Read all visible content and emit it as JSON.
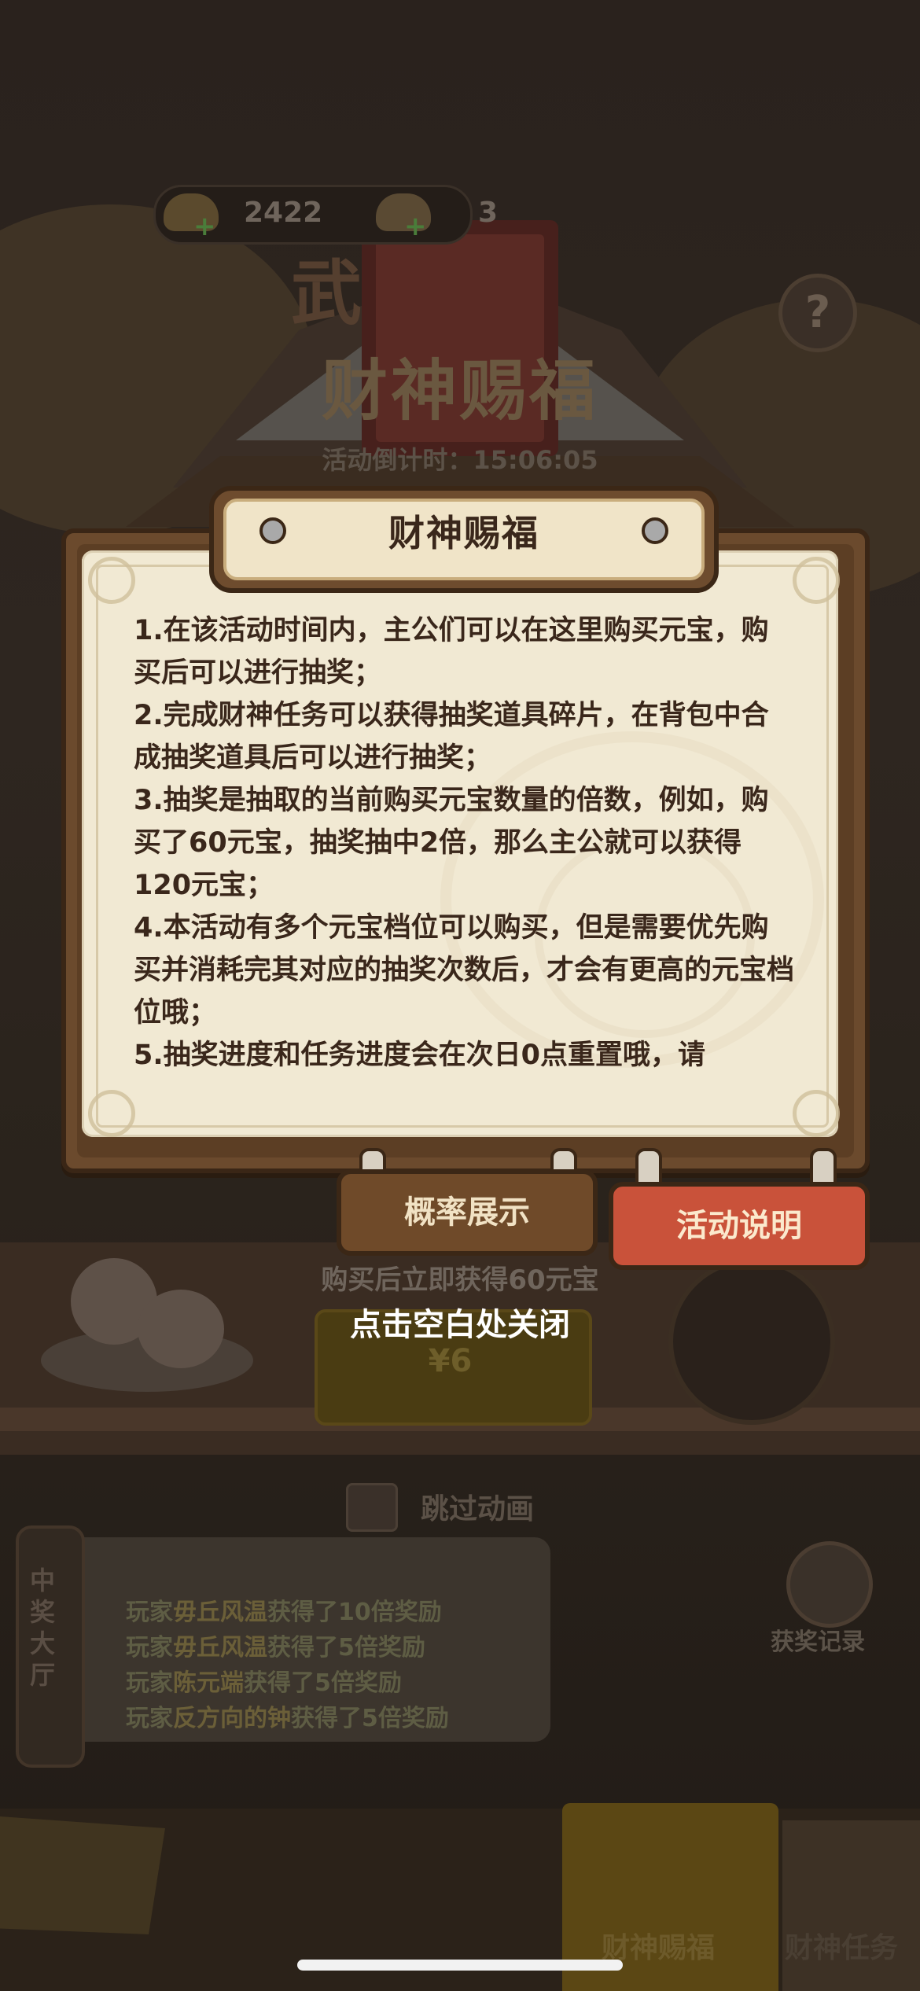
{
  "background": {
    "currency": {
      "ingots": "2422",
      "fragments": "3"
    },
    "event_title": "财神赐福",
    "countdown": "活动倒计时：15:06:05",
    "banner_char": "武",
    "buy_hint": "购买后立即获得60元宝",
    "price": "¥6",
    "skip_animation": "跳过动画",
    "hall_label": "中奖大厅",
    "news": [
      {
        "prefix": "玩家",
        "name": "毋丘风温",
        "suffix": "获得了10倍奖励"
      },
      {
        "prefix": "玩家",
        "name": "毋丘风温",
        "suffix": "获得了5倍奖励"
      },
      {
        "prefix": "玩家",
        "name": "陈元端",
        "suffix": "获得了5倍奖励"
      },
      {
        "prefix": "玩家",
        "name": "反方向的钟",
        "suffix": "获得了5倍奖励"
      }
    ],
    "record_label": "获奖记录",
    "tabs": {
      "active": "财神赐福",
      "other": "财神任务"
    }
  },
  "modal": {
    "title": "财神赐福",
    "paragraphs": [
      "1.在该活动时间内，主公们可以在这里购买元宝，购买后可以进行抽奖；",
      "2.完成财神任务可以获得抽奖道具碎片，在背包中合成抽奖道具后可以进行抽奖；",
      "3.抽奖是抽取的当前购买元宝数量的倍数，例如，购买了60元宝，抽奖抽中2倍，那么主公就可以获得120元宝；",
      "4.本活动有多个元宝档位可以购买，但是需要优先购买并消耗完其对应的抽奖次数后，才会有更高的元宝档位哦；",
      "5.抽奖进度和任务进度会在次日0点重置哦，请"
    ],
    "buttons": {
      "probability": "概率展示",
      "description": "活动说明"
    },
    "close_hint": "点击空白处关闭"
  }
}
